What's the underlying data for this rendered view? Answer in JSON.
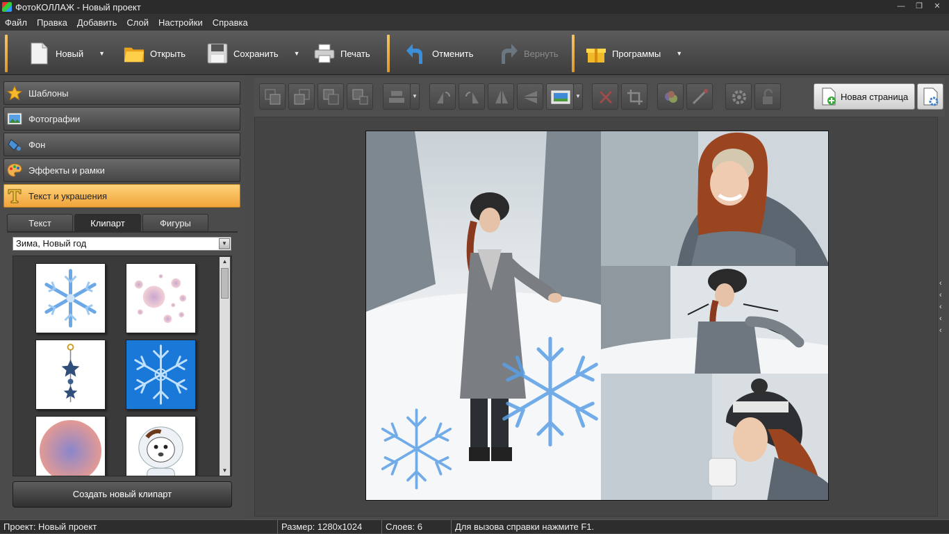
{
  "window": {
    "title": "ФотоКОЛЛАЖ - Новый проект"
  },
  "menu": [
    "Файл",
    "Правка",
    "Добавить",
    "Слой",
    "Настройки",
    "Справка"
  ],
  "toolbar": {
    "new": "Новый",
    "open": "Открыть",
    "save": "Сохранить",
    "print": "Печать",
    "undo": "Отменить",
    "redo": "Вернуть",
    "programs": "Программы"
  },
  "sidebar": {
    "sections": [
      "Шаблоны",
      "Фотографии",
      "Фон",
      "Эффекты и рамки",
      "Текст и украшения"
    ],
    "active_section": "Текст и украшения",
    "tabs": [
      "Текст",
      "Клипарт",
      "Фигуры"
    ],
    "active_tab": "Клипарт",
    "category": "Зима, Новый год",
    "create_clipart": "Создать новый клипарт"
  },
  "canvas": {
    "new_page": "Новая страница"
  },
  "statusbar": {
    "project": "Проект:  Новый проект",
    "size": "Размер:  1280x1024",
    "layers": "Слоев:  6",
    "hint": "Для вызова справки нажмите F1."
  },
  "colors": {
    "accent": "#f0a43a",
    "snowflake": "#5aa0e6"
  }
}
